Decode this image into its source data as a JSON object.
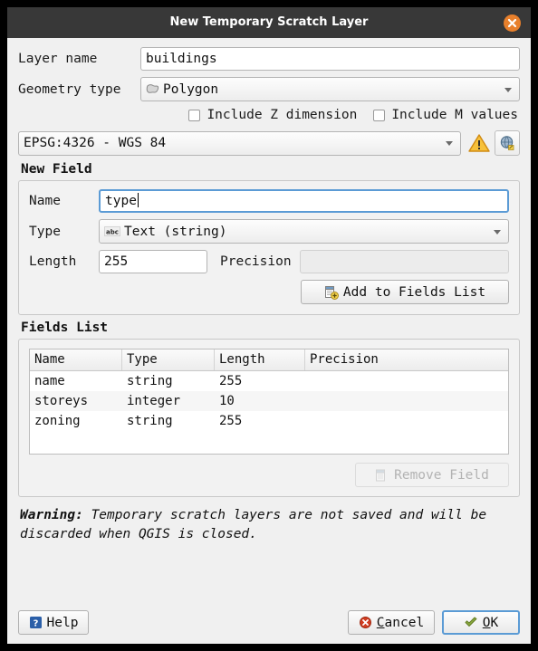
{
  "window": {
    "title": "New Temporary Scratch Layer",
    "close_icon": "close-icon",
    "accent_orange": "#e8802c",
    "titlebar_color": "#383838",
    "focus_blue": "#5b9bd5"
  },
  "layer": {
    "name_label": "Layer name",
    "name_value": "buildings",
    "geometry_label": "Geometry type",
    "geometry_value": "Polygon",
    "geometry_icon": "polygon-icon"
  },
  "dimensions": {
    "include_z_label": "Include Z dimension",
    "include_z_checked": false,
    "include_m_label": "Include M values",
    "include_m_checked": false
  },
  "crs": {
    "value": "EPSG:4326 - WGS 84",
    "warning_icon": "warning-triangle-icon",
    "select_crs_icon": "select-crs-globe-icon"
  },
  "new_field": {
    "group_title": "New Field",
    "name_label": "Name",
    "name_value": "type",
    "type_label": "Type",
    "type_value": "Text (string)",
    "type_icon": "abc-text-icon",
    "length_label": "Length",
    "length_value": "255",
    "precision_label": "Precision",
    "precision_value": "",
    "add_button_label": "Add to Fields List",
    "add_button_icon": "add-field-icon"
  },
  "fields_list": {
    "group_title": "Fields List",
    "columns": [
      "Name",
      "Type",
      "Length",
      "Precision"
    ],
    "rows": [
      {
        "name": "name",
        "type": "string",
        "length": "255",
        "precision": ""
      },
      {
        "name": "storeys",
        "type": "integer",
        "length": "10",
        "precision": ""
      },
      {
        "name": "zoning",
        "type": "string",
        "length": "255",
        "precision": ""
      }
    ],
    "remove_button_label": "Remove Field",
    "remove_button_icon": "remove-field-icon",
    "remove_button_enabled": false
  },
  "warning": {
    "prefix": "Warning:",
    "text": "Temporary scratch layers are not saved and will be discarded when QGIS is closed."
  },
  "footer": {
    "help_label": "Help",
    "help_icon": "help-question-icon",
    "cancel_label": "Cancel",
    "cancel_icon": "cancel-x-icon",
    "ok_label": "OK",
    "ok_icon": "ok-check-icon"
  }
}
